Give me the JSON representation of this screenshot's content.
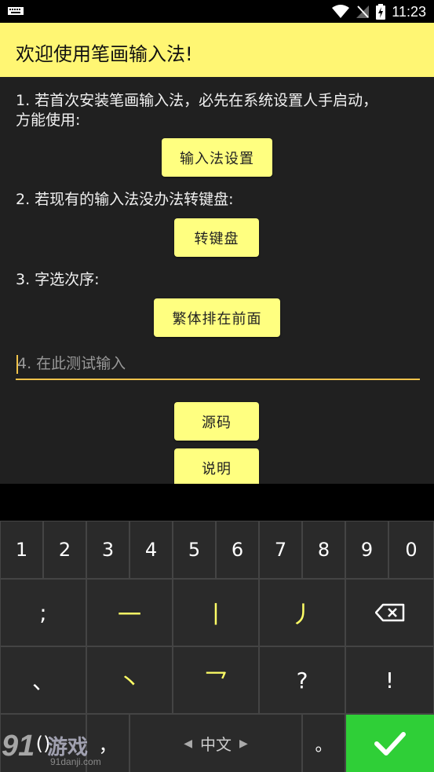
{
  "status": {
    "time": "11:23"
  },
  "title": "欢迎使用笔画输入法!",
  "content": {
    "line1": "1. 若首次安装笔画输入法，必先在系统设置人手启动，",
    "line1b": "方能使用:",
    "btn_settings": "输入法设置",
    "line2": "2. 若现有的输入法没办法转键盘:",
    "btn_switch": "转键盘",
    "line3": "3. 字选次序:",
    "btn_order": "繁体排在前面",
    "input_placeholder": "4. 在此测试输入",
    "input_value": "",
    "btn_source": "源码",
    "btn_help": "说明"
  },
  "keyboard": {
    "numbers": [
      "1",
      "2",
      "3",
      "4",
      "5",
      "6",
      "7",
      "8",
      "9",
      "0"
    ],
    "row2": {
      "semicolon": ";",
      "heng": "一",
      "shu": "丨",
      "pie": "丿"
    },
    "row3": {
      "dunhao": "、",
      "dian": "丶",
      "zhe": "乛",
      "question": "?",
      "exclaim": "!"
    },
    "row4": {
      "paren": "()",
      "comma": "，",
      "lang_left": "◀",
      "lang": "中文",
      "lang_right": "▶",
      "period": "。"
    }
  },
  "watermark": {
    "brand": "游戏",
    "site": "91danji.com",
    "num": "91"
  },
  "colors": {
    "accent": "#fff673",
    "button": "#ffff80",
    "stroke_key": "#ffff66",
    "ok_key": "#2fcf37",
    "underline": "#f0c34b"
  },
  "icons": [
    "keyboard-icon",
    "wifi-icon",
    "no-sim-icon",
    "battery-charging-icon",
    "backspace-icon",
    "check-icon"
  ]
}
